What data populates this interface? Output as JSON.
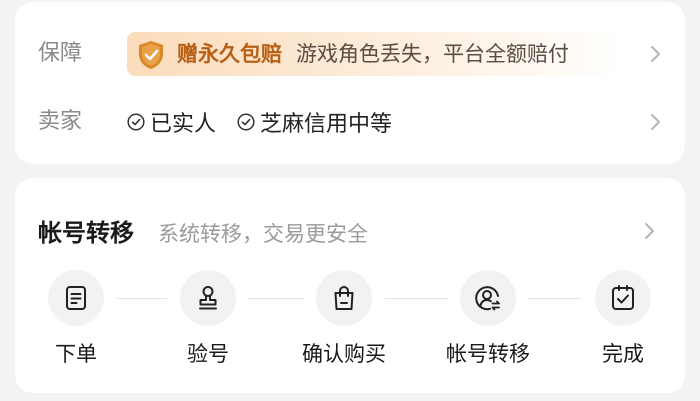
{
  "guarantee": {
    "label": "保障",
    "badge": "赠永久包赔",
    "text": "游戏角色丢失，平台全额赔付",
    "icon": "shield-check-icon"
  },
  "seller": {
    "label": "卖家",
    "tags": [
      "已实人",
      "芝麻信用中等"
    ]
  },
  "transfer": {
    "title": "帐号转移",
    "subtitle": "系统转移，交易更安全",
    "steps": [
      {
        "label": "下单",
        "icon": "order-document-icon"
      },
      {
        "label": "验号",
        "icon": "stamp-icon"
      },
      {
        "label": "确认购买",
        "icon": "shopping-bag-icon"
      },
      {
        "label": "帐号转移",
        "icon": "account-transfer-icon"
      },
      {
        "label": "完成",
        "icon": "clipboard-check-icon"
      }
    ]
  },
  "colors": {
    "accent": "#b85f16",
    "shield": "#d9892a",
    "card_bg": "#ffffff",
    "page_bg": "#f3f3f5"
  }
}
